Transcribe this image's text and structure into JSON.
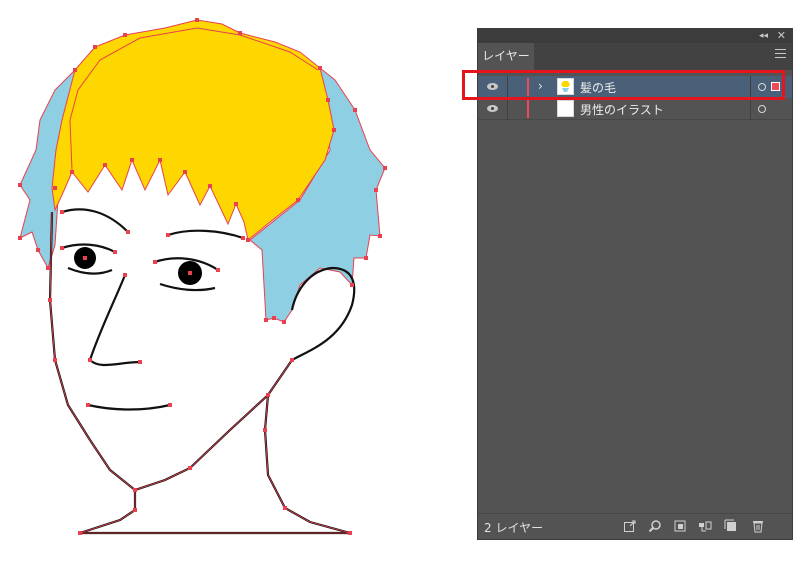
{
  "panel": {
    "tab_label": "レイヤー",
    "collapse_glyph": "◂◂",
    "close_glyph": "✕",
    "layers": [
      {
        "name": "髪の毛",
        "expanded": false,
        "visible": true,
        "selected": true,
        "color": "#f04a5a"
      },
      {
        "name": "男性のイラスト",
        "visible": true,
        "selected": false,
        "color": "#f04a5a"
      }
    ],
    "footer": {
      "count_label": "2 レイヤー",
      "icons": [
        "export-icon",
        "locate-object-icon",
        "make-clipping-mask-icon",
        "create-sublayer-icon",
        "new-layer-icon",
        "delete-icon"
      ]
    }
  },
  "colors": {
    "hair_yellow": "#ffd700",
    "hair_blue": "#8ecfe3",
    "anchor_red": "#e8414f",
    "panel_bg": "#535353",
    "selected_row": "#4a6079",
    "highlight_red": "#e4151c"
  }
}
